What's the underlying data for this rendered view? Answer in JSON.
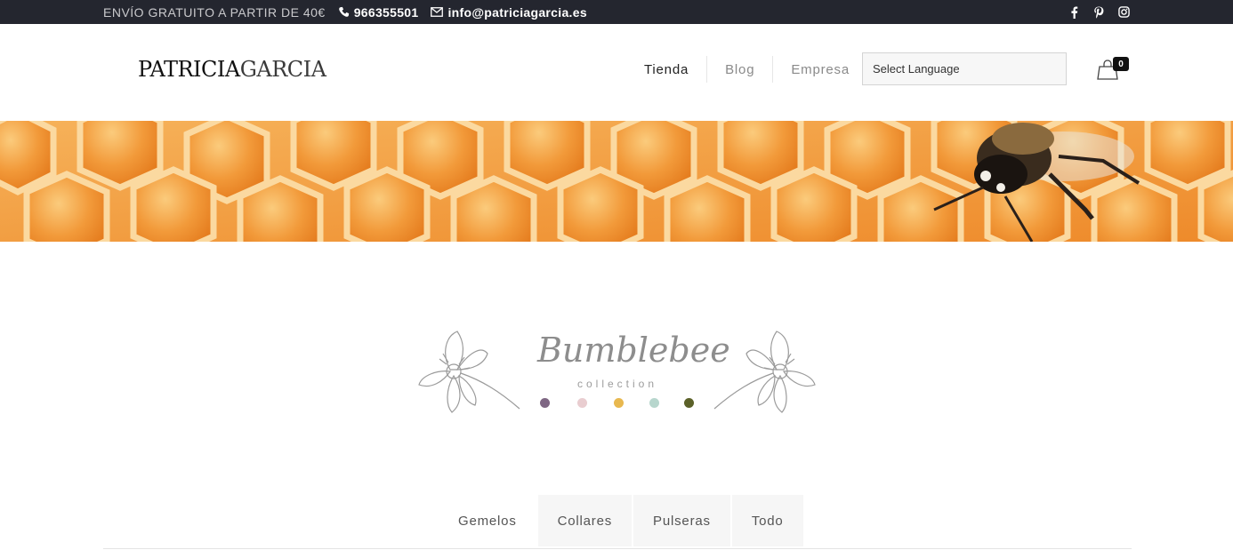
{
  "topbar": {
    "shipping": "ENVÍO GRATUITO A PARTIR DE 40€",
    "phone": "966355501",
    "email": "info@patriciagarcia.es",
    "icons": [
      "phone-icon",
      "mail-icon"
    ],
    "social": [
      "facebook-icon",
      "pinterest-icon",
      "instagram-icon"
    ]
  },
  "header": {
    "logo_part1": "PATRICIA",
    "logo_part2": "GARCIA",
    "nav": [
      {
        "label": "Tienda"
      },
      {
        "label": "Blog"
      },
      {
        "label": "Empresa"
      }
    ],
    "language_select": "Select Language",
    "cart_count": "0"
  },
  "collection": {
    "title": "Bumblebee",
    "subtitle": "collection",
    "dot_colors": [
      "#7e6683",
      "#e9cdd0",
      "#e8b84f",
      "#b7d6cd",
      "#5b6128"
    ]
  },
  "tabs": [
    {
      "label": "Gemelos"
    },
    {
      "label": "Collares"
    },
    {
      "label": "Pulseras"
    },
    {
      "label": "Todo"
    }
  ],
  "colors": {
    "topbar_bg": "#24262f",
    "honey": "#f39a38"
  }
}
